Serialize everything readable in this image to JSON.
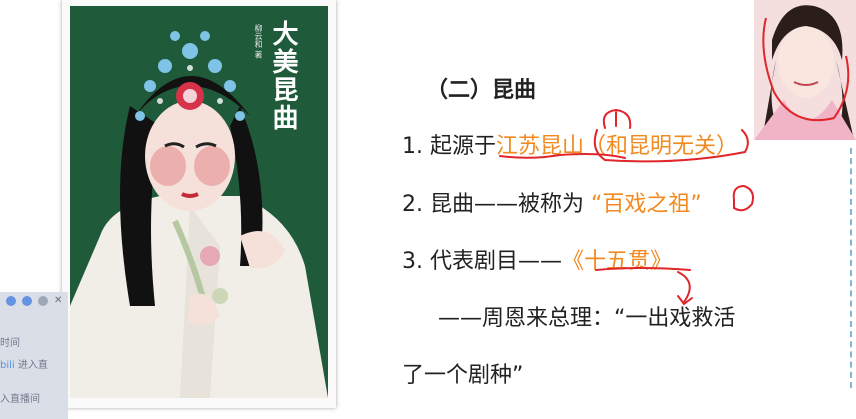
{
  "photo": {
    "title": "大美昆曲",
    "subtitle": "柳云和 著"
  },
  "slide": {
    "heading": "（二）昆曲",
    "line1": {
      "prefix": "1. 起源于",
      "highlight": "江苏昆山（和昆明无关）"
    },
    "line2": {
      "prefix": "2. 昆曲——被称为 ",
      "highlight": "“百戏之祖”"
    },
    "line3": {
      "prefix": "3. 代表剧目——",
      "highlight": "《十五贯》"
    },
    "line4": "——周恩来总理：“一出戏救活",
    "line5": "了一个剧种”"
  },
  "stream_panel": {
    "line1": "时间",
    "line2_highlight": "bili",
    "line2_rest": " 进入直",
    "line3": "入直播间"
  },
  "colors": {
    "highlight": "#f28a1f",
    "annotation": "#e0262a"
  }
}
